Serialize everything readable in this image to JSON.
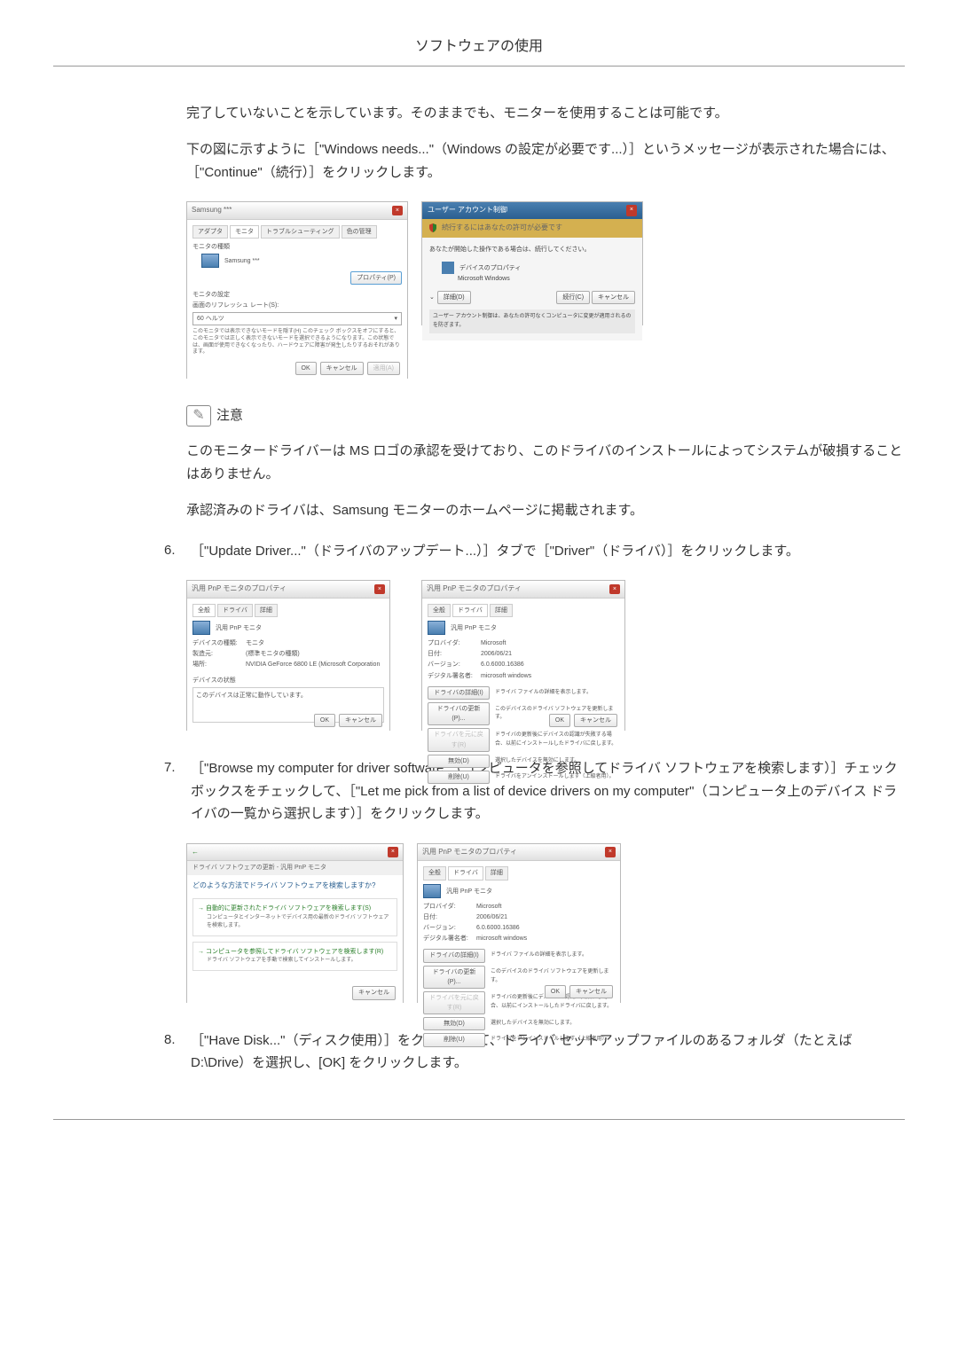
{
  "header": {
    "title": "ソフトウェアの使用"
  },
  "intro": {
    "p1": "完了していないことを示しています。そのままでも、モニターを使用することは可能です。",
    "p2": "下の図に示すように［\"Windows needs...\"（Windows の設定が必要です...）］というメッセージが表示された場合には、［\"Continue\"（続行）］をクリックします。"
  },
  "fig1": {
    "title": "Samsung ***",
    "tab1": "アダプタ",
    "tab2": "モニタ",
    "tab3": "トラブルシューティング",
    "tab4": "色の管理",
    "section1": "モニタの種類",
    "monitor_name": "Samsung ***",
    "prop_btn": "プロパティ(P)",
    "section2": "モニタの設定",
    "refresh_label": "画面のリフレッシュ レート(S):",
    "refresh_val": "60 ヘルツ",
    "note_text": "このモニタでは表示できないモードを隠す(H)\nこのチェック ボックスをオフにすると、このモニタでは正しく表示できないモードを選択できるようになります。この状態では、画面が使用できなくなったり、ハードウェアに障害が発生したりするおそれがあります。",
    "ok": "OK",
    "cancel": "キャンセル",
    "apply": "適用(A)"
  },
  "fig2": {
    "title": "ユーザー アカウント制御",
    "sub": "続行するにはあなたの許可が必要です",
    "line1": "あなたが開始した操作である場合は、続行してください。",
    "dev": "デバイスのプロパティ",
    "dev2": "Microsoft Windows",
    "details": "詳細(D)",
    "continue": "続行(C)",
    "cancel": "キャンセル",
    "footer": "ユーザー アカウント制御は、あなたの許可なくコンピュータに変更が適用されるのを防ぎます。"
  },
  "note": {
    "label": "注意"
  },
  "note_body": {
    "p1": "このモニタードライバーは MS ロゴの承認を受けており、このドライバのインストールによってシステムが破損することはありません。",
    "p2": "承認済みのドライバは、Samsung モニターのホームページに掲載されます。"
  },
  "step6": {
    "num": "6.",
    "text": "［\"Update Driver...\"（ドライバのアップデート...）］タブで［\"Driver\"（ドライバ）］をクリックします。"
  },
  "fig3": {
    "title": "汎用 PnP モニタのプロパティ",
    "tab1": "全般",
    "tab2": "ドライバ",
    "tab3": "詳細",
    "device": "汎用 PnP モニタ",
    "l1": "デバイスの種類:",
    "v1": "モニタ",
    "l2": "製造元:",
    "v2": "(標準モニタの種類)",
    "l3": "場所:",
    "v3": "NVIDIA GeForce 6800 LE (Microsoft Corporation",
    "status_label": "デバイスの状態",
    "status": "このデバイスは正常に動作しています。",
    "ok": "OK",
    "cancel": "キャンセル"
  },
  "fig4": {
    "title": "汎用 PnP モニタのプロパティ",
    "tab1": "全般",
    "tab2": "ドライバ",
    "tab3": "詳細",
    "device": "汎用 PnP モニタ",
    "l1": "プロバイダ:",
    "v1": "Microsoft",
    "l2": "日付:",
    "v2": "2006/06/21",
    "l3": "バージョン:",
    "v3": "6.0.6000.16386",
    "l4": "デジタル署名者:",
    "v4": "microsoft windows",
    "b1": "ドライバの詳細(I)",
    "d1": "ドライバ ファイルの詳細を表示します。",
    "b2": "ドライバの更新(P)...",
    "d2": "このデバイスのドライバ ソフトウェアを更新します。",
    "b3": "ドライバを元に戻す(R)",
    "d3": "ドライバの更新後にデバイスの認識が失敗する場合、以前にインストールしたドライバに戻します。",
    "b4": "無効(D)",
    "d4": "選択したデバイスを無効にします。",
    "b5": "削除(U)",
    "d5": "ドライバをアンインストールします（上級者用）。",
    "ok": "OK",
    "cancel": "キャンセル"
  },
  "step7": {
    "num": "7.",
    "text": "［\"Browse my computer for driver software\"（コンピュータを参照してドライバ ソフトウェアを検索します）］チェックボックスをチェックして、［\"Let me pick from a list of device drivers on my computer\"（コンピュータ上のデバイス ドライバの一覧から選択します）］をクリックします。"
  },
  "fig5": {
    "title": "ドライバ ソフトウェアの更新 - 汎用 PnP モニタ",
    "q": "どのような方法でドライバ ソフトウェアを検索しますか?",
    "opt1_t": "自動的に更新されたドライバ ソフトウェアを検索します(S)",
    "opt1_d": "コンピュータとインターネットでデバイス用の最新のドライバ ソフトウェアを検索します。",
    "opt2_t": "コンピュータを参照してドライバ ソフトウェアを検索します(R)",
    "opt2_d": "ドライバ ソフトウェアを手動で検索してインストールします。",
    "cancel": "キャンセル"
  },
  "step8": {
    "num": "8.",
    "text": "［\"Have Disk...\"（ディスク使用）］をクリックして、ドライバ セットアップファイルのあるフォルダ（たとえば D:\\Drive）を選択し、[OK] をクリックします。"
  }
}
